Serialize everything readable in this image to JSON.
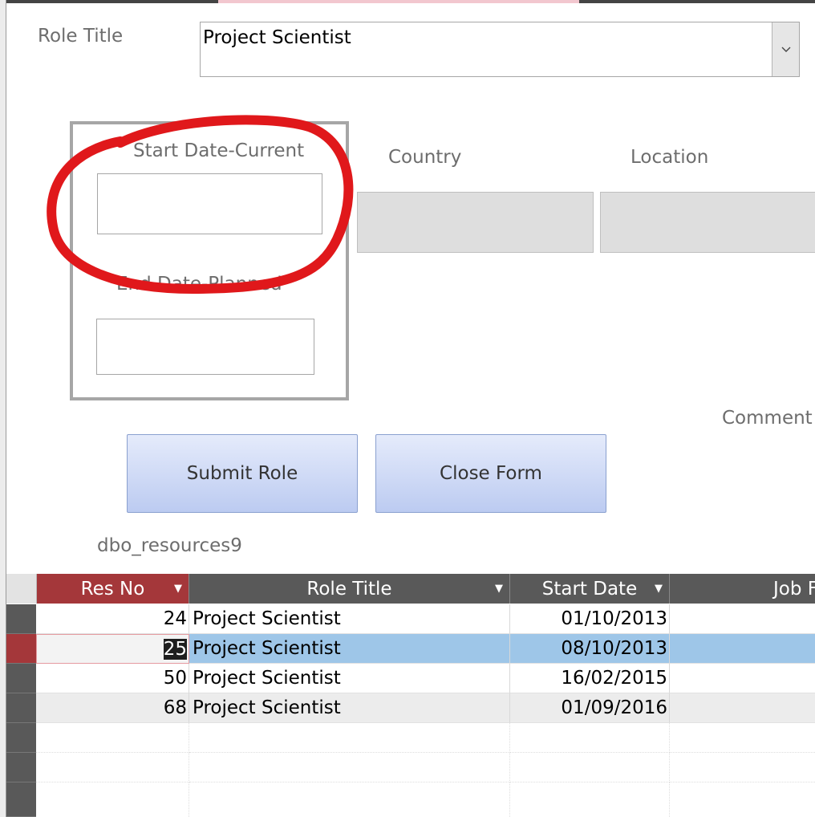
{
  "form": {
    "role_title_label": "Role Title",
    "role_title_value": "Project Scientist",
    "start_date_label": "Start Date-Current",
    "end_date_label": "End Date-Planned",
    "country_label": "Country",
    "location_label": "Location",
    "comment_label": "Comment",
    "submit_label": "Submit Role",
    "close_label": "Close Form",
    "datasheet_caption": "dbo_resources9"
  },
  "table": {
    "columns": [
      "Res No",
      "Role Title",
      "Start Date",
      "Job F"
    ],
    "rows": [
      {
        "res_no": "24",
        "role": "Project Scientist",
        "start": "01/10/2013"
      },
      {
        "res_no": "25",
        "role": "Project Scientist",
        "start": "08/10/2013"
      },
      {
        "res_no": "50",
        "role": "Project Scientist",
        "start": "16/02/2015"
      },
      {
        "res_no": "68",
        "role": "Project Scientist",
        "start": "01/09/2016"
      }
    ]
  },
  "colors": {
    "annotation": "#e0181b",
    "header_active": "#a4373a",
    "selected_row": "#9ec6e8"
  }
}
